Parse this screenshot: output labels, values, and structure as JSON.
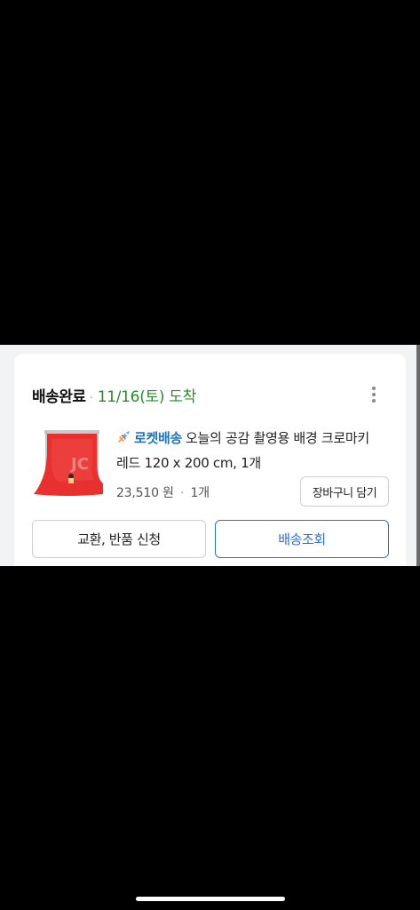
{
  "order": {
    "status": "배송완료",
    "separator": "·",
    "arrival_date": "11/16(토) 도착",
    "more_icon": "vertical-ellipsis-icon"
  },
  "product": {
    "thumbnail_icon": "red-backdrop-product-image",
    "rocket_icon": "rocket-icon",
    "delivery_badge": "로켓배송",
    "name_line1": "오늘의 공감 촬영용 배경 크로마키",
    "name_line2": "레드 120 x 200 cm, 1개",
    "price": "23,510 원",
    "price_separator": "·",
    "quantity": "1개",
    "cart_button": "장바구니 담기"
  },
  "actions": {
    "exchange_return": "교환, 반품 신청",
    "track_delivery": "배송조회"
  },
  "colors": {
    "date_green": "#2b8a2f",
    "rocket_blue": "#1a73c4",
    "track_blue": "#2e6fd0",
    "product_red": "#e8302e"
  }
}
